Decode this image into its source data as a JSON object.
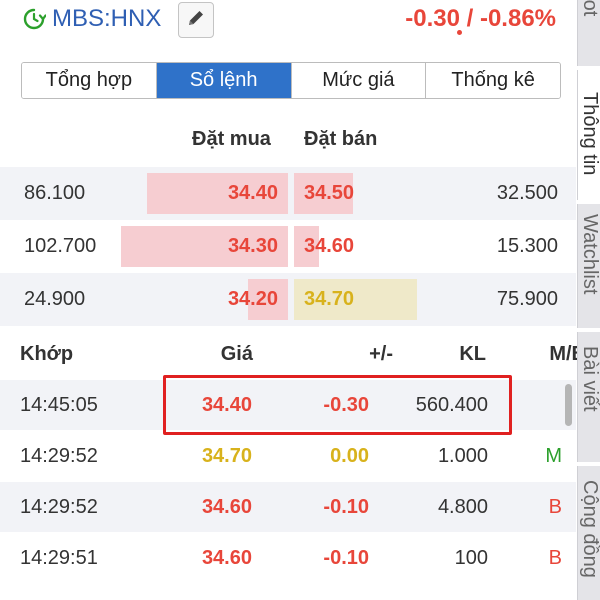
{
  "header": {
    "symbol": "MBS:HNX",
    "change": "-0.30 / -0.86%",
    "icons": {
      "clock": "clock-icon",
      "edit": "pencil-icon"
    }
  },
  "tabs": [
    {
      "label": "Tổng hợp",
      "active": false
    },
    {
      "label": "Sổ lệnh",
      "active": true
    },
    {
      "label": "Mức giá",
      "active": false
    },
    {
      "label": "Thống kê",
      "active": false
    }
  ],
  "orderbook": {
    "buy_header": "Đặt mua",
    "sell_header": "Đặt bán",
    "rows": [
      {
        "buy_vol": "86.100",
        "buy_price": "34.40",
        "sell_price": "34.50",
        "sell_vol": "32.500"
      },
      {
        "buy_vol": "102.700",
        "buy_price": "34.30",
        "sell_price": "34.60",
        "sell_vol": "15.300"
      },
      {
        "buy_vol": "24.900",
        "buy_price": "34.20",
        "sell_price": "34.70",
        "sell_vol": "75.900"
      }
    ]
  },
  "trades": {
    "headers": {
      "time": "Khớp",
      "price": "Giá",
      "change": "+/-",
      "volume": "KL",
      "side": "M/B"
    },
    "rows": [
      {
        "time": "14:45:05",
        "price": "34.40",
        "change": "-0.30",
        "volume": "560.400",
        "side": ""
      },
      {
        "time": "14:29:52",
        "price": "34.70",
        "change": "0.00",
        "volume": "1.000",
        "side": "M"
      },
      {
        "time": "14:29:52",
        "price": "34.60",
        "change": "-0.10",
        "volume": "4.800",
        "side": "B"
      },
      {
        "time": "14:29:51",
        "price": "34.60",
        "change": "-0.10",
        "volume": "100",
        "side": "B"
      }
    ]
  },
  "side_tabs": [
    {
      "label": "Copilot",
      "active": false
    },
    {
      "label": "Thông tin",
      "active": true
    },
    {
      "label": "Watchlist",
      "active": false
    },
    {
      "label": "Bài viết",
      "active": false
    },
    {
      "label": "Cộng đồng",
      "active": false
    }
  ],
  "colors": {
    "brand": "#2f5fb3",
    "active_tab": "#2f72c9",
    "down": "#e8463a",
    "ref": "#d8b21c",
    "up": "#2ca02c",
    "buy_bar": "#f6cdd1",
    "sell_bar_down": "#f6cdd1",
    "sell_bar_ref": "#efe9c9",
    "highlight": "#e02020"
  }
}
